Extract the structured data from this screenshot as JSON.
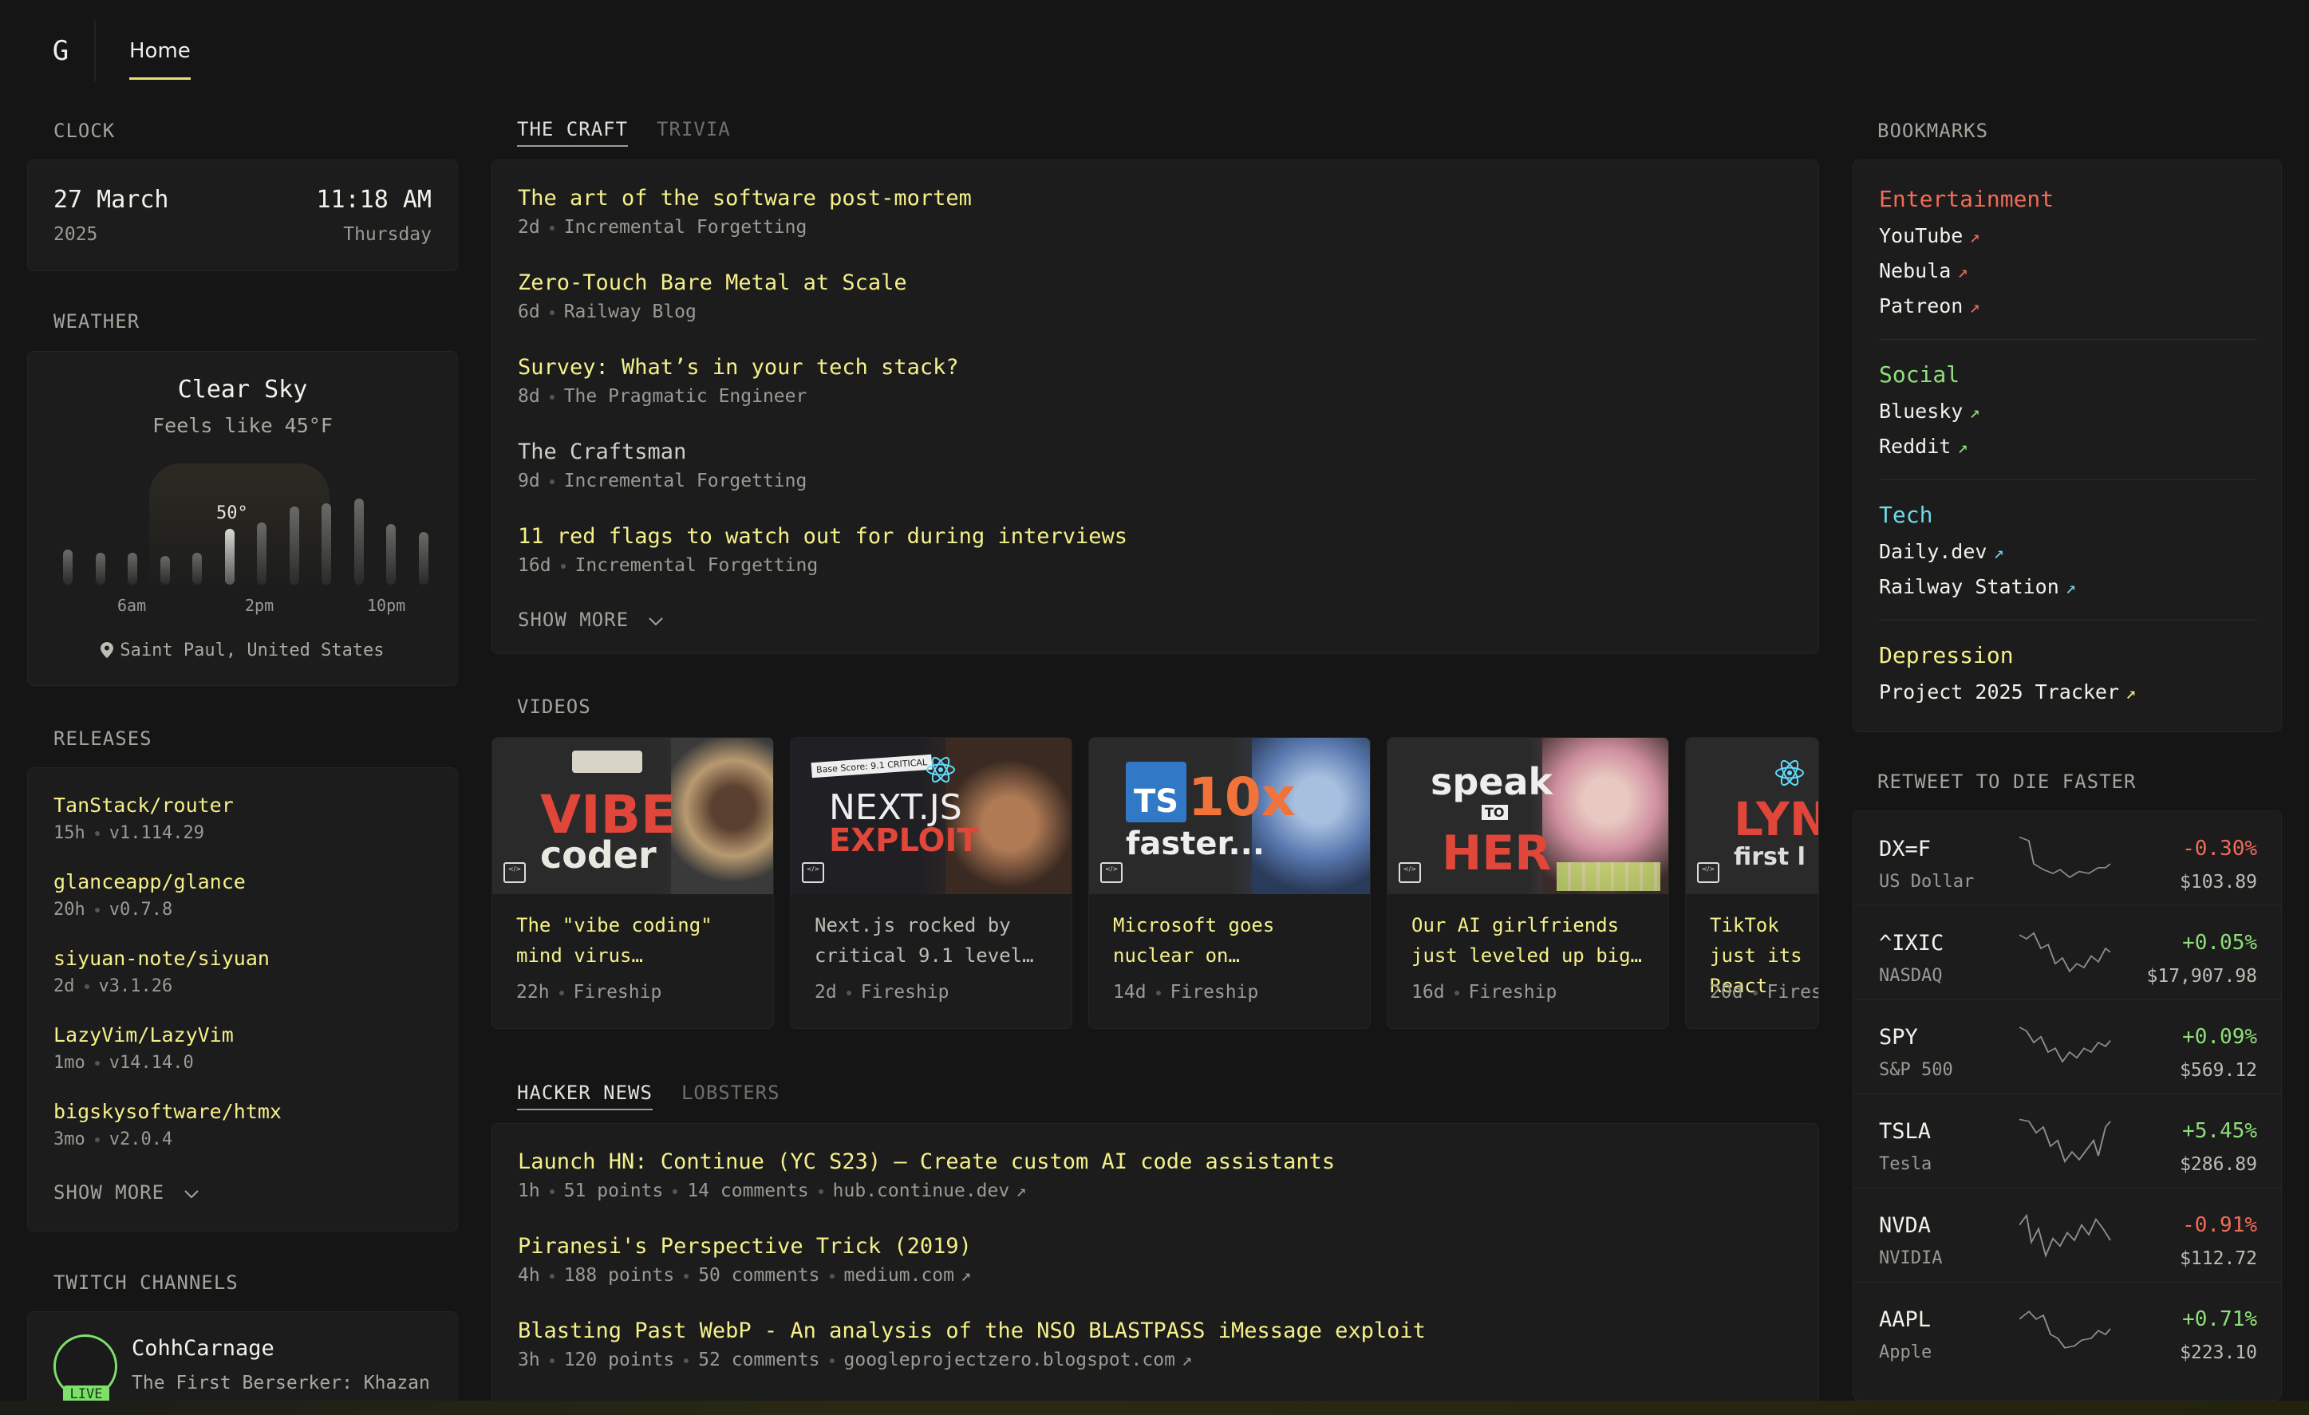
{
  "nav": {
    "logo": "G",
    "home": "Home"
  },
  "clock": {
    "title": "CLOCK",
    "date": "27 March",
    "year": "2025",
    "time": "11:18 AM",
    "day": "Thursday"
  },
  "weather": {
    "title": "WEATHER",
    "condition": "Clear Sky",
    "feels": "Feels like 45°F",
    "current_temp": "50°",
    "hour_labels": [
      "6am",
      "2pm",
      "10pm"
    ],
    "location": "Saint Paul, United States"
  },
  "releases": {
    "title": "RELEASES",
    "items": [
      {
        "name": "TanStack/router",
        "age": "15h",
        "version": "v1.114.29"
      },
      {
        "name": "glanceapp/glance",
        "age": "20h",
        "version": "v0.7.8"
      },
      {
        "name": "siyuan-note/siyuan",
        "age": "2d",
        "version": "v3.1.26"
      },
      {
        "name": "LazyVim/LazyVim",
        "age": "1mo",
        "version": "v14.14.0"
      },
      {
        "name": "bigskysoftware/htmx",
        "age": "3mo",
        "version": "v2.0.4"
      }
    ],
    "show_more": "SHOW MORE"
  },
  "twitch": {
    "title": "TWITCH CHANNELS",
    "channel": "CohhCarnage",
    "game": "The First Berserker: Khazan",
    "live": "LIVE"
  },
  "craft": {
    "tabs": [
      "THE CRAFT",
      "TRIVIA"
    ],
    "items": [
      {
        "title": "The art of the software post-mortem",
        "age": "2d",
        "source": "Incremental Forgetting"
      },
      {
        "title": "Zero-Touch Bare Metal at Scale",
        "age": "6d",
        "source": "Railway Blog"
      },
      {
        "title": "Survey: What’s in your tech stack?",
        "age": "8d",
        "source": "The Pragmatic Engineer"
      },
      {
        "title": "The Craftsman",
        "age": "9d",
        "source": "Incremental Forgetting"
      },
      {
        "title": "11 red flags to watch out for during interviews",
        "age": "16d",
        "source": "Incremental Forgetting"
      }
    ],
    "show_more": "SHOW MORE"
  },
  "videos": {
    "title": "VIDEOS",
    "items": [
      {
        "thumb_a": "VIBE",
        "thumb_b": "coder",
        "title": "The \"vibe coding\" mind virus…",
        "age": "22h",
        "channel": "Fireship"
      },
      {
        "thumb_a": "NEXT.JS",
        "thumb_b": "EXPLOIT",
        "thumb_c": "Base Score: 9.1 CRITICAL",
        "title": "Next.js rocked by critical 9.1 level…",
        "age": "2d",
        "channel": "Fireship"
      },
      {
        "thumb_a": "TS",
        "thumb_b": "10x",
        "thumb_c": "faster...",
        "title": "Microsoft goes nuclear on…",
        "age": "14d",
        "channel": "Fireship"
      },
      {
        "thumb_a": "speak",
        "thumb_b": "TO",
        "thumb_c": "HER",
        "title": "Our AI girlfriends just leveled up big…",
        "age": "16d",
        "channel": "Fireship"
      },
      {
        "thumb_a": "LYN",
        "thumb_b": "first l",
        "title": "TikTok just its React",
        "age": "20d",
        "channel": "Fires"
      }
    ],
    "code_badge": "CODE REPORT"
  },
  "news": {
    "tabs": [
      "HACKER NEWS",
      "LOBSTERS"
    ],
    "items": [
      {
        "title": "Launch HN: Continue (YC S23) – Create custom AI code assistants",
        "age": "1h",
        "points": "51 points",
        "comments": "14 comments",
        "domain": "hub.continue.dev"
      },
      {
        "title": "Piranesi's Perspective Trick (2019)",
        "age": "4h",
        "points": "188 points",
        "comments": "50 comments",
        "domain": "medium.com"
      },
      {
        "title": "Blasting Past WebP - An analysis of the NSO BLASTPASS iMessage exploit",
        "age": "3h",
        "points": "120 points",
        "comments": "52 comments",
        "domain": "googleprojectzero.blogspot.com"
      }
    ]
  },
  "bookmarks": {
    "title": "BOOKMARKS",
    "groups": [
      {
        "name": "Entertainment",
        "color": "#f06b58",
        "links": [
          "YouTube",
          "Nebula",
          "Patreon"
        ]
      },
      {
        "name": "Social",
        "color": "#8ee07a",
        "links": [
          "Bluesky",
          "Reddit"
        ]
      },
      {
        "name": "Tech",
        "color": "#6fd8e8",
        "links": [
          "Daily.dev",
          "Railway Station"
        ]
      },
      {
        "name": "Depression",
        "color": "#f5f08a",
        "links": [
          "Project 2025 Tracker"
        ]
      }
    ]
  },
  "stocks": {
    "title": "RETWEET TO DIE FASTER",
    "items": [
      {
        "symbol": "DX=F",
        "name": "US Dollar",
        "change": "-0.30%",
        "price": "$103.89",
        "dir": "neg"
      },
      {
        "symbol": "^IXIC",
        "name": "NASDAQ",
        "change": "+0.05%",
        "price": "$17,907.98",
        "dir": "pos"
      },
      {
        "symbol": "SPY",
        "name": "S&P 500",
        "change": "+0.09%",
        "price": "$569.12",
        "dir": "pos"
      },
      {
        "symbol": "TSLA",
        "name": "Tesla",
        "change": "+5.45%",
        "price": "$286.89",
        "dir": "pos"
      },
      {
        "symbol": "NVDA",
        "name": "NVIDIA",
        "change": "-0.91%",
        "price": "$112.72",
        "dir": "neg"
      },
      {
        "symbol": "AAPL",
        "name": "Apple",
        "change": "+0.71%",
        "price": "$223.10",
        "dir": "pos"
      }
    ]
  }
}
